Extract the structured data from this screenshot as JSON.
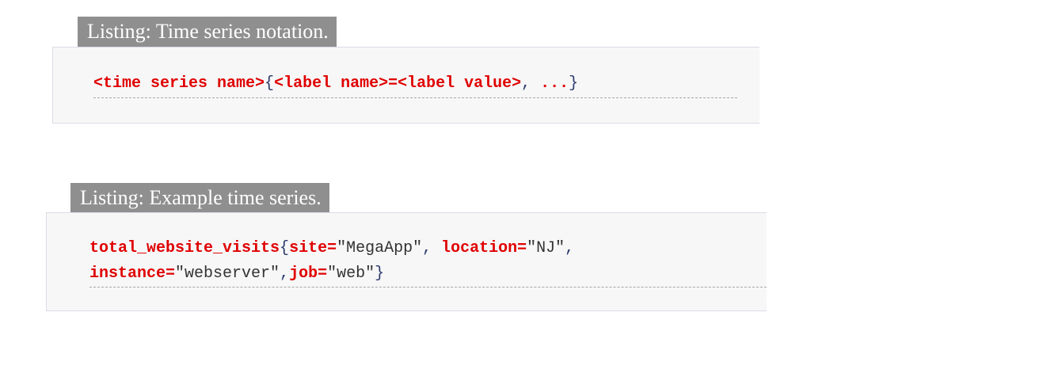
{
  "listings": [
    {
      "caption": "Listing:  Time series notation.",
      "code": {
        "metric": "<time series name>",
        "open_brace": "{",
        "label_name": "<label name>",
        "equals": "=",
        "label_value": "<label value>",
        "sep": ", ",
        "ellipsis": "...",
        "close_brace": "}"
      }
    },
    {
      "caption": "Listing:  Example time series.",
      "code": {
        "metric": "total_website_visits",
        "open_brace": "{",
        "site_key": "site=",
        "site_val": "\"MegaApp\"",
        "comma1": ", ",
        "location_key": "location=",
        "location_val": "\"NJ\"",
        "comma2": ",",
        "instance_key": "instance=",
        "instance_val": "\"webserver\"",
        "comma3": ",",
        "job_key": "job=",
        "job_val": "\"web\"",
        "close_brace": "}"
      }
    }
  ]
}
